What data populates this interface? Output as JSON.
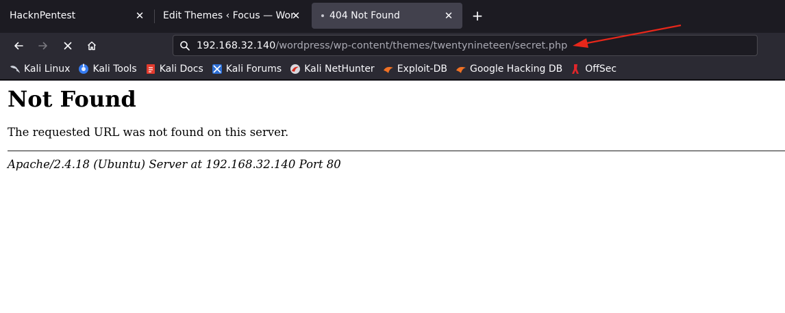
{
  "tabs": [
    {
      "title": "HacknPentest",
      "close": "✕"
    },
    {
      "title": "Edit Themes ‹ Focus — WordPress",
      "close": "✕"
    },
    {
      "title": "404 Not Found",
      "close": "✕",
      "active": true
    }
  ],
  "new_tab": "+",
  "nav": {
    "back": "arrow-left-icon",
    "forward": "arrow-right-icon",
    "stop": "close-icon",
    "home": "home-icon"
  },
  "url": {
    "host": "192.168.32.140",
    "path": "/wordpress/wp-content/themes/twentynineteen/secret.php"
  },
  "bookmarks": [
    {
      "label": "Kali Linux",
      "icon": "kali-dragon-icon"
    },
    {
      "label": "Kali Tools",
      "icon": "kali-tools-icon"
    },
    {
      "label": "Kali Docs",
      "icon": "kali-docs-icon"
    },
    {
      "label": "Kali Forums",
      "icon": "kali-forums-icon"
    },
    {
      "label": "Kali NetHunter",
      "icon": "nethunter-icon"
    },
    {
      "label": "Exploit-DB",
      "icon": "exploit-db-icon"
    },
    {
      "label": "Google Hacking DB",
      "icon": "ghdb-icon"
    },
    {
      "label": "OffSec",
      "icon": "offsec-icon"
    }
  ],
  "page": {
    "heading": "Not Found",
    "message": "The requested URL was not found on this server.",
    "server_signature": "Apache/2.4.18 (Ubuntu) Server at 192.168.32.140 Port 80"
  },
  "colors": {
    "chrome_dark": "#1c1b22",
    "toolbar": "#2b2a33",
    "active_tab": "#42414d",
    "annotation_arrow": "#e8271a"
  }
}
